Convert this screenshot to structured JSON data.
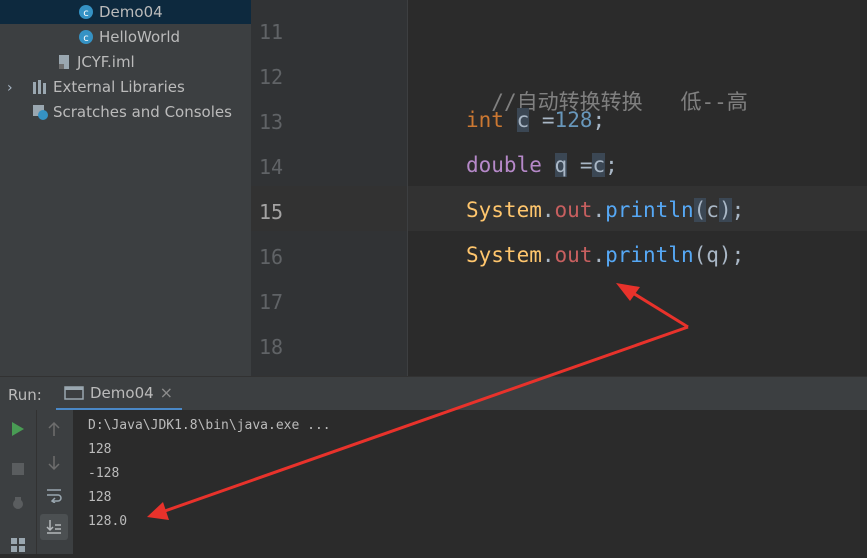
{
  "project_tree": {
    "items": [
      {
        "label": "Demo04",
        "icon": "java-class-icon"
      },
      {
        "label": "HelloWorld",
        "icon": "java-class-icon"
      },
      {
        "label": "JCYF.iml",
        "icon": "iml-file-icon"
      },
      {
        "label": "External Libraries",
        "icon": "libraries-icon"
      },
      {
        "label": "Scratches and Consoles",
        "icon": "scratches-icon"
      }
    ]
  },
  "editor": {
    "line_numbers": [
      "11",
      "12",
      "13",
      "14",
      "15",
      "16",
      "17",
      "18"
    ],
    "current_line": "15",
    "lines": {
      "l12_comment": "//自动转换转换   低--高",
      "l13_kw": "int",
      "l13_var": "c",
      "l13_eq": " =",
      "l13_num": "128",
      "l13_semi": ";",
      "l14_kw": "double",
      "l14_var": "q",
      "l14_eq": " =",
      "l14_ref": "c",
      "l14_semi": ";",
      "l15_cls": "System",
      "l15_dot1": ".",
      "l15_fld": "out",
      "l15_dot2": ".",
      "l15_mth": "println",
      "l15_lp": "(",
      "l15_arg": "c",
      "l15_rp": ")",
      "l15_semi": ";",
      "l16_cls": "System",
      "l16_dot1": ".",
      "l16_fld": "out",
      "l16_dot2": ".",
      "l16_mth": "println",
      "l16_args": "(q)",
      "l16_semi": ";"
    }
  },
  "run_panel": {
    "label": "Run:",
    "tab_label": "Demo04",
    "close_glyph": "×",
    "output": [
      "D:\\Java\\JDK1.8\\bin\\java.exe ...",
      "128",
      "-128",
      "128",
      "128.0"
    ]
  },
  "colors": {
    "annotation_arrow": "#e8322b"
  }
}
